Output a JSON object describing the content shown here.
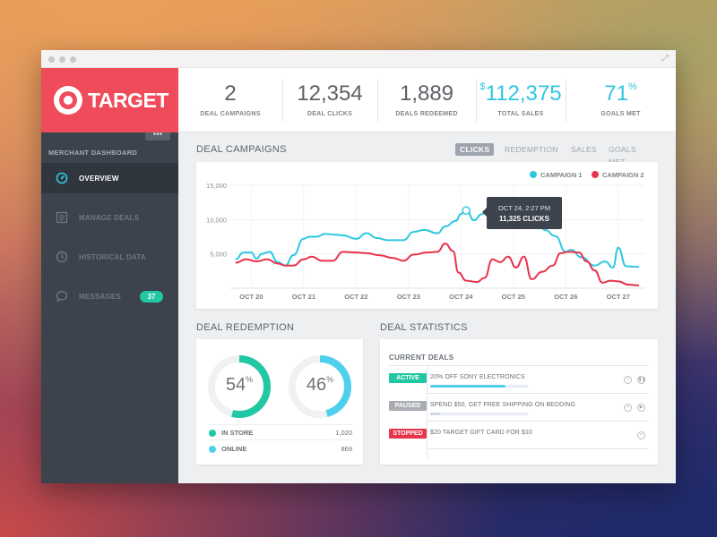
{
  "brand": {
    "name": "TARGET"
  },
  "sidebar": {
    "heading": "MERCHANT DASHBOARD",
    "more": "•••",
    "items": [
      {
        "label": "OVERVIEW",
        "icon": "gauge-icon",
        "active": true
      },
      {
        "label": "MANAGE DEALS",
        "icon": "list-icon",
        "active": false
      },
      {
        "label": "HISTORICAL DATA",
        "icon": "clock-icon",
        "active": false
      },
      {
        "label": "MESSAGES",
        "icon": "chat-bubble-icon",
        "active": false,
        "badge": "37"
      }
    ]
  },
  "stats": [
    {
      "value": "2",
      "prefix": "",
      "suffix": "",
      "label": "DEAL CAMPAIGNS"
    },
    {
      "value": "12,354",
      "prefix": "",
      "suffix": "",
      "label": "DEAL CLICKS"
    },
    {
      "value": "1,889",
      "prefix": "",
      "suffix": "",
      "label": "DEALS REDEEMED"
    },
    {
      "value": "112,375",
      "prefix": "$",
      "suffix": "",
      "label": "TOTAL SALES"
    },
    {
      "value": "71",
      "prefix": "",
      "suffix": "%",
      "label": "GOALS MET"
    }
  ],
  "campaigns": {
    "title": "DEAL CAMPAIGNS",
    "tabs": [
      "CLICKS",
      "REDEMPTION",
      "SALES",
      "GOALS MET"
    ],
    "active_tab": "CLICKS",
    "tooltip": {
      "date": "OCT 24, 2:27 PM",
      "value": "11,325 CLICKS"
    }
  },
  "chart_data": {
    "type": "line",
    "x": [
      "OCT 20",
      "OCT 21",
      "OCT 22",
      "OCT 23",
      "OCT 24",
      "OCT 25",
      "OCT 26",
      "OCT 27"
    ],
    "yticks": [
      "15,000",
      "10,000",
      "5,000"
    ],
    "ylim": [
      0,
      15000
    ],
    "grid": true,
    "legend_position": "top-right",
    "series": [
      {
        "name": "CAMPAIGN 1",
        "color": "#2ec7e0",
        "points": [
          [
            19.7,
            4200
          ],
          [
            19.85,
            5200
          ],
          [
            20.0,
            5200
          ],
          [
            20.1,
            4300
          ],
          [
            20.2,
            5000
          ],
          [
            20.35,
            5300
          ],
          [
            20.5,
            3800
          ],
          [
            20.65,
            3300
          ],
          [
            20.8,
            4800
          ],
          [
            21.0,
            7200
          ],
          [
            21.1,
            7500
          ],
          [
            21.25,
            7500
          ],
          [
            21.4,
            7900
          ],
          [
            21.6,
            7800
          ],
          [
            21.75,
            7700
          ],
          [
            22.0,
            7200
          ],
          [
            22.2,
            8000
          ],
          [
            22.4,
            7300
          ],
          [
            22.6,
            7000
          ],
          [
            22.9,
            7000
          ],
          [
            23.1,
            8200
          ],
          [
            23.3,
            8500
          ],
          [
            23.55,
            8000
          ],
          [
            23.7,
            9000
          ],
          [
            23.9,
            9800
          ],
          [
            24.0,
            10800
          ],
          [
            24.1,
            11400
          ],
          [
            24.25,
            9900
          ],
          [
            24.4,
            10800
          ],
          [
            24.55,
            11900
          ],
          [
            24.7,
            10800
          ],
          [
            24.85,
            10200
          ],
          [
            25.0,
            11300
          ],
          [
            25.2,
            9600
          ],
          [
            25.4,
            11600
          ],
          [
            25.6,
            8500
          ],
          [
            25.8,
            7600
          ],
          [
            26.0,
            5300
          ],
          [
            26.1,
            5600
          ],
          [
            26.3,
            4500
          ],
          [
            26.55,
            3300
          ],
          [
            26.75,
            3900
          ],
          [
            26.9,
            3000
          ],
          [
            27.0,
            5900
          ],
          [
            27.15,
            3200
          ],
          [
            27.4,
            3100
          ]
        ]
      },
      {
        "name": "CAMPAIGN 2",
        "color": "#e8344c",
        "points": [
          [
            19.7,
            3700
          ],
          [
            19.9,
            4200
          ],
          [
            20.1,
            3900
          ],
          [
            20.3,
            4200
          ],
          [
            20.5,
            3600
          ],
          [
            20.65,
            3300
          ],
          [
            20.8,
            3300
          ],
          [
            21.0,
            4200
          ],
          [
            21.15,
            4600
          ],
          [
            21.35,
            4000
          ],
          [
            21.55,
            4000
          ],
          [
            21.75,
            5300
          ],
          [
            22.0,
            5200
          ],
          [
            22.2,
            5100
          ],
          [
            22.45,
            4800
          ],
          [
            22.7,
            4400
          ],
          [
            22.9,
            4000
          ],
          [
            23.1,
            4900
          ],
          [
            23.35,
            5200
          ],
          [
            23.55,
            5300
          ],
          [
            23.7,
            6500
          ],
          [
            23.85,
            5400
          ],
          [
            23.95,
            2300
          ],
          [
            24.1,
            1100
          ],
          [
            24.3,
            900
          ],
          [
            24.45,
            1500
          ],
          [
            24.6,
            4200
          ],
          [
            24.75,
            3800
          ],
          [
            24.9,
            4600
          ],
          [
            25.05,
            3000
          ],
          [
            25.2,
            4600
          ],
          [
            25.35,
            1300
          ],
          [
            25.55,
            2400
          ],
          [
            25.75,
            3300
          ],
          [
            25.9,
            5100
          ],
          [
            26.05,
            5300
          ],
          [
            26.25,
            5200
          ],
          [
            26.4,
            3900
          ],
          [
            26.55,
            2600
          ],
          [
            26.7,
            800
          ],
          [
            26.85,
            1100
          ],
          [
            27.0,
            1000
          ],
          [
            27.2,
            500
          ],
          [
            27.4,
            400
          ]
        ]
      }
    ],
    "highlight": {
      "series": "CAMPAIGN 1",
      "x": 24.1,
      "y": 11325
    }
  },
  "redemption": {
    "title": "DEAL REDEMPTION",
    "donuts": [
      {
        "value": "54",
        "unit": "%",
        "fraction": 0.54,
        "color": "#22c7a4"
      },
      {
        "value": "46",
        "unit": "%",
        "fraction": 0.46,
        "color": "#4ed0ec"
      }
    ],
    "legend": [
      {
        "label": "IN STORE",
        "value": "1,020",
        "color": "#22c7a4"
      },
      {
        "label": "ONLINE",
        "value": "869",
        "color": "#4ed0ec"
      }
    ]
  },
  "deal_stats": {
    "title": "DEAL STATISTICS",
    "current_deals_label": "CURRENT DEALS",
    "deals": [
      {
        "status": "ACTIVE",
        "status_color": "#22c7a4",
        "text": "20% OFF SONY ELECTRONICS",
        "progress": 0.76,
        "progress_color": "#4ed0ec",
        "actions": [
          "close-icon",
          "pause-icon"
        ]
      },
      {
        "status": "PAUSED",
        "status_color": "#a9adb3",
        "text": "SPEND $50, GET FREE SHIPPING ON BEDDING",
        "progress": 0.1,
        "progress_color": "#cfd6de",
        "actions": [
          "close-icon",
          "play-icon"
        ]
      },
      {
        "status": "STOPPED",
        "status_color": "#e8344c",
        "text": "$20 TARGET GIFT CARD FOR $10",
        "progress": 0,
        "progress_color": "#cfd6de",
        "actions": [
          "close-icon"
        ]
      }
    ]
  }
}
